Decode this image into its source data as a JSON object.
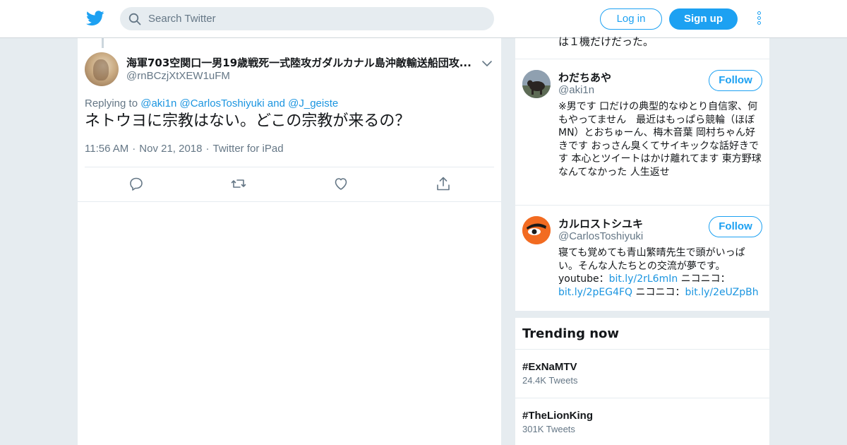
{
  "header": {
    "search_placeholder": "Search Twitter",
    "login_label": "Log in",
    "signup_label": "Sign up",
    "logo_icon": "twitter-bird-icon",
    "more_icon": "vertical-dots-icon",
    "accent": "#1da1f2"
  },
  "tweet": {
    "author_name": "海軍703空関口一男19歳戦死一式陸攻ガダルカナル島沖敵輸送船団攻...",
    "author_handle": "@rnBCzjXtXEW1uFM",
    "replying_prefix": "Replying to",
    "replying_mention_1": "@aki1n",
    "replying_mention_2": "@CarlosToshiyuki",
    "replying_and": "and",
    "replying_mention_3": "@J_geiste",
    "text": "ネトウヨに宗教はない。どこの宗教が来るの？",
    "time": "11:56 AM",
    "date": "Nov 21, 2018",
    "source": "Twitter for iPad",
    "action_icons": [
      "reply-icon",
      "retweet-icon",
      "like-icon",
      "share-icon"
    ]
  },
  "sidebar": {
    "previous_bio_tail": "は１機だけだった。",
    "users": [
      {
        "name": "わだちあや",
        "handle": "@aki1n",
        "follow_label": "Follow",
        "bio": "※男です 口だけの典型的なゆとり自信家、何もやってません　最近はもっぱら競輪（ほぼMN）とおちゅーん、梅木音葉 岡村ちゃん好きです おっさん臭くてサイキックな話好きです 本心とツイートはかけ離れてます 東方野球なんてなかった 人生返せ"
      },
      {
        "name": "カルロストシユキ",
        "handle": "@CarlosToshiyuki",
        "follow_label": "Follow",
        "bio_text_1": "寝ても覚めても青山繁晴先生で頭がいっぱい。そんな人たちとの交流が夢です。",
        "bio_text_2": "youtube：",
        "bio_link_1": "bit.ly/2rL6mIn",
        "bio_text_3": " ニコニコ：",
        "bio_link_2": "bit.ly/2pEG4FQ",
        "bio_text_4": " ニコニコ：",
        "bio_link_3": "bit.ly/2eUZpBh"
      }
    ]
  },
  "trends": {
    "title": "Trending now",
    "items": [
      {
        "name": "#ExNaMTV",
        "count": "24.4K Tweets"
      },
      {
        "name": "#TheLionKing",
        "count": "301K Tweets"
      }
    ]
  }
}
